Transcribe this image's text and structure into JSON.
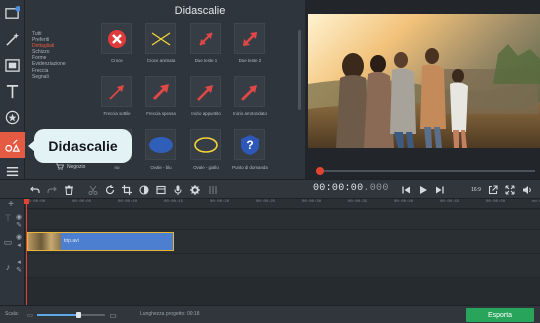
{
  "gallery": {
    "title": "Didascalie",
    "items": [
      {
        "label": "Croce",
        "icon": "cross-circle-icon"
      },
      {
        "label": "Croce animata",
        "icon": "cross-lines-icon"
      },
      {
        "label": "Due teste 1",
        "icon": "double-arrow-icon"
      },
      {
        "label": "Due teste 2",
        "icon": "double-arrow-icon"
      },
      {
        "label": "Freccia sottile",
        "icon": "thin-arrow-icon"
      },
      {
        "label": "Freccia spessa",
        "icon": "thick-arrow-icon"
      },
      {
        "label": "Inizio appuntito",
        "icon": "pointed-arrow-icon"
      },
      {
        "label": "Inizio arrotondato",
        "icon": "rounded-arrow-icon"
      },
      {
        "label": "no",
        "icon": "no-icon"
      },
      {
        "label": "Ovale - blu",
        "icon": "blue-oval-icon"
      },
      {
        "label": "Ovale - giallo",
        "icon": "yellow-oval-icon"
      },
      {
        "label": "Punto di domanda",
        "icon": "question-mark-icon"
      }
    ]
  },
  "categories": {
    "items": [
      "Tutti",
      "Preferiti",
      "Dettagliati",
      "Schizzo",
      "Forme",
      "Evidenziazione",
      "Freccia",
      "Segnali"
    ],
    "selected": "Dettagliati",
    "shop_label": "Negozio"
  },
  "tooltip": {
    "text": "Didascalie"
  },
  "player": {
    "timecode_main": "00:00:00",
    "timecode_ms": ".000",
    "aspect_label": "16:9"
  },
  "timeline": {
    "ruler": [
      "00:00:00",
      "00:00:05",
      "00:00:10",
      "00:00:15",
      "00:00:20",
      "00:00:25",
      "00:00:30",
      "00:00:35",
      "00:00:40",
      "00:00:45",
      "00:00:50",
      "00:00:55"
    ],
    "clip_name": "trip.avi"
  },
  "status": {
    "scale_label": "Scala:",
    "duration": "Lunghezza progetto: 00:18",
    "zoom_level": 0.6
  },
  "export_label": "Esporta",
  "colors": {
    "accent": "#e45a43",
    "export": "#29a55b",
    "clip": "#4c7fcf",
    "playhead": "#e34432"
  }
}
